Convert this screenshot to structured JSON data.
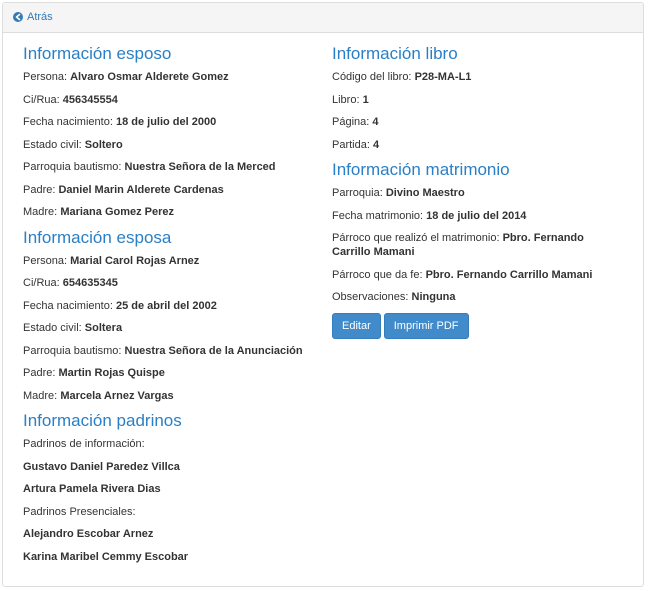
{
  "header": {
    "back_label": "Atrás"
  },
  "esposo": {
    "title": "Información esposo",
    "rows": [
      {
        "label": "Persona:",
        "value": "Alvaro Osmar Alderete Gomez"
      },
      {
        "label": "Ci/Rua:",
        "value": "456345554"
      },
      {
        "label": "Fecha nacimiento:",
        "value": "18 de julio del 2000"
      },
      {
        "label": "Estado civil:",
        "value": "Soltero"
      },
      {
        "label": "Parroquia bautismo:",
        "value": "Nuestra Señora de la Merced"
      },
      {
        "label": "Padre:",
        "value": "Daniel Marin Alderete Cardenas"
      },
      {
        "label": "Madre:",
        "value": "Mariana Gomez Perez"
      }
    ]
  },
  "esposa": {
    "title": "Información esposa",
    "rows": [
      {
        "label": "Persona:",
        "value": "Marial Carol Rojas Arnez"
      },
      {
        "label": "Ci/Rua:",
        "value": "654635345"
      },
      {
        "label": "Fecha nacimiento:",
        "value": "25 de abril del 2002"
      },
      {
        "label": "Estado civil:",
        "value": "Soltera"
      },
      {
        "label": "Parroquia bautismo:",
        "value": "Nuestra Señora de la Anunciación"
      },
      {
        "label": "Padre:",
        "value": "Martin Rojas Quispe"
      },
      {
        "label": "Madre:",
        "value": "Marcela Arnez Vargas"
      }
    ]
  },
  "padrinos": {
    "title": "Información padrinos",
    "info_label": "Padrinos de información:",
    "info_names": [
      "Gustavo Daniel Paredez Villca",
      "Artura Pamela Rivera Dias"
    ],
    "presenciales_label": "Padrinos Presenciales:",
    "presenciales_names": [
      "Alejandro Escobar Arnez",
      "Karina Maribel Cemmy Escobar"
    ]
  },
  "libro": {
    "title": "Información libro",
    "rows": [
      {
        "label": "Código del libro:",
        "value": "P28-MA-L1"
      },
      {
        "label": "Libro:",
        "value": "1"
      },
      {
        "label": "Página:",
        "value": "4"
      },
      {
        "label": "Partida:",
        "value": "4"
      }
    ]
  },
  "matrimonio": {
    "title": "Información matrimonio",
    "rows": [
      {
        "label": "Parroquia:",
        "value": "Divino Maestro"
      },
      {
        "label": "Fecha matrimonio:",
        "value": "18 de julio del 2014"
      },
      {
        "label": "Párroco que realizó el matrimonio:",
        "value": "Pbro. Fernando Carrillo Mamani"
      },
      {
        "label": "Párroco que da fe:",
        "value": "Pbro. Fernando Carrillo Mamani"
      },
      {
        "label": "Observaciones:",
        "value": "Ninguna"
      }
    ]
  },
  "actions": {
    "edit_label": "Editar",
    "print_label": "Imprimir PDF"
  },
  "colors": {
    "heading": "#2a7fc6",
    "button": "#428bca"
  }
}
